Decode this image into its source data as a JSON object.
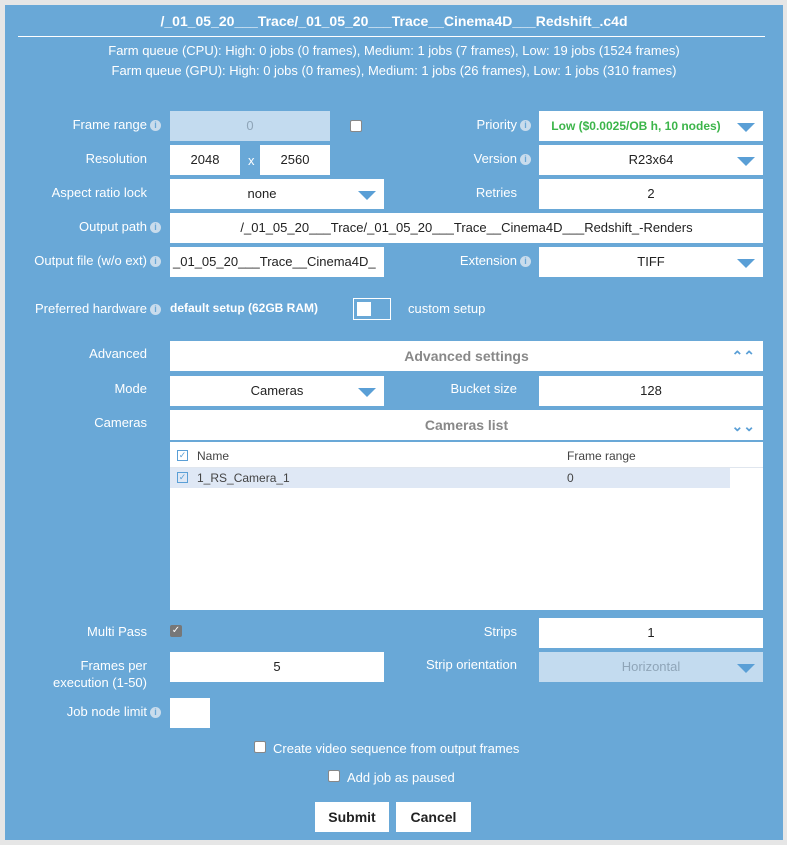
{
  "title": "/_01_05_20___Trace/_01_05_20___Trace__Cinema4D___Redshift_.c4d",
  "queue": {
    "cpu": "Farm queue (CPU): High: 0 jobs (0 frames), Medium: 1 jobs (7 frames), Low: 19 jobs (1524 frames)",
    "gpu": "Farm queue (GPU): High: 0 jobs (0 frames), Medium: 1 jobs (26 frames), Low: 1 jobs (310 frames)"
  },
  "form": {
    "frame_range": {
      "label": "Frame range",
      "value": "0",
      "checked": false
    },
    "resolution": {
      "label": "Resolution",
      "width": "2048",
      "sep": "x",
      "height": "2560"
    },
    "aspect": {
      "label": "Aspect ratio lock",
      "value": "none"
    },
    "output_path": {
      "label": "Output path",
      "value": "/_01_05_20___Trace/_01_05_20___Trace__Cinema4D___Redshift_-Renders"
    },
    "output_file": {
      "label": "Output file (w/o ext)",
      "value": "_01_05_20___Trace__Cinema4D_"
    },
    "priority": {
      "label": "Priority",
      "value": "Low ($0.0025/OB h, 10 nodes)",
      "color": "#3cb54a"
    },
    "version": {
      "label": "Version",
      "value": "R23x64"
    },
    "retries": {
      "label": "Retries",
      "value": "2"
    },
    "extension": {
      "label": "Extension",
      "value": "TIFF"
    },
    "hardware": {
      "label": "Preferred hardware",
      "default": "default setup (62GB RAM)",
      "custom": "custom setup"
    },
    "advanced": {
      "label": "Advanced",
      "header": "Advanced settings"
    },
    "mode": {
      "label": "Mode",
      "value": "Cameras"
    },
    "bucket": {
      "label": "Bucket size",
      "value": "128"
    },
    "cameras": {
      "label": "Cameras",
      "header": "Cameras list",
      "columns": [
        "Name",
        "Frame range"
      ],
      "rows": [
        {
          "name": "1_RS_Camera_1",
          "range": "0",
          "checked": true
        }
      ]
    },
    "multipass": {
      "label": "Multi Pass",
      "checked": true
    },
    "strips": {
      "label": "Strips",
      "value": "1"
    },
    "fpe": {
      "label": "Frames per execution (1-50)",
      "value": "5"
    },
    "strip_orientation": {
      "label": "Strip orientation",
      "value": "Horizontal"
    },
    "node_limit": {
      "label": "Job node limit",
      "value": ""
    },
    "video": {
      "label": "Create video sequence from output frames",
      "checked": false
    },
    "paused": {
      "label": "Add job as paused",
      "checked": false
    }
  },
  "buttons": {
    "submit": "Submit",
    "cancel": "Cancel"
  }
}
